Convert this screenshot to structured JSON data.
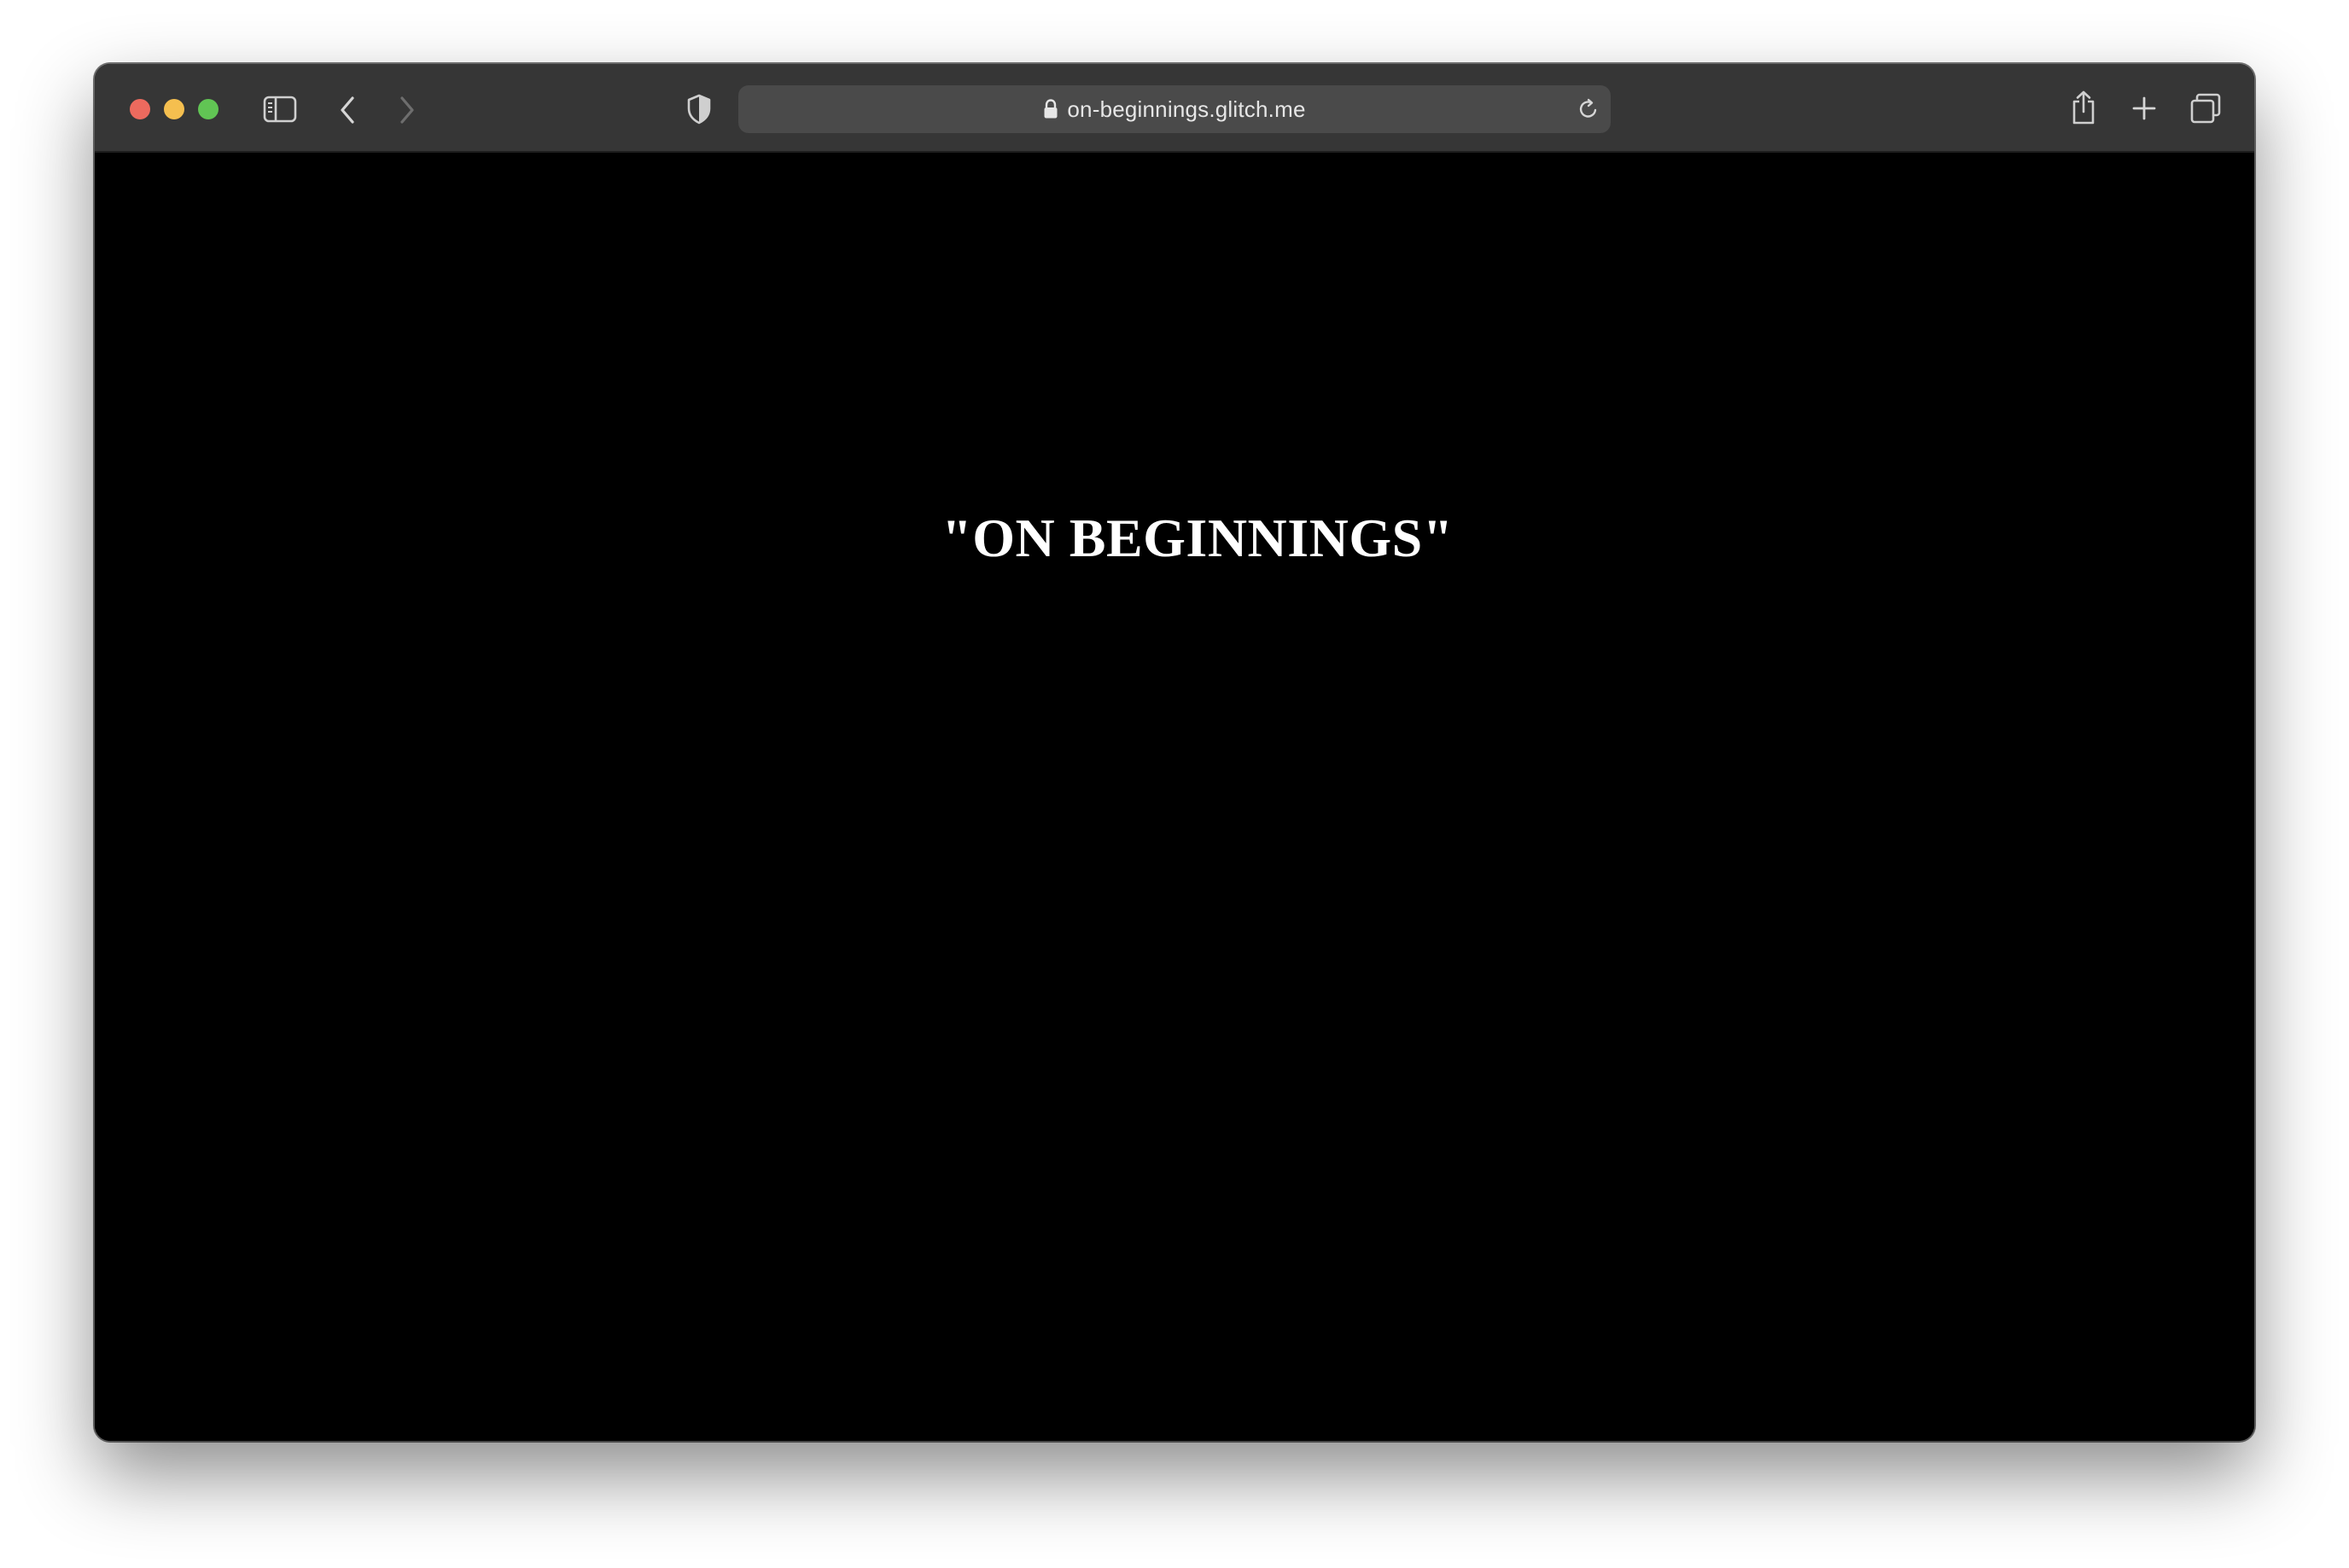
{
  "browser": {
    "address_bar": {
      "url": "on-beginnings.glitch.me"
    },
    "icons": {
      "sidebar": "sidebar-toggle-icon",
      "back": "chevron-left-icon",
      "forward": "chevron-right-icon",
      "privacy": "shield-icon",
      "lock": "lock-icon",
      "reload": "reload-icon",
      "share": "share-icon",
      "new_tab": "plus-icon",
      "tabs": "tab-overview-icon"
    },
    "colors": {
      "toolbar": "#363636",
      "address_bar": "#4a4a4a",
      "close": "#ed6a5e",
      "minimize": "#f5bf4f",
      "zoom": "#61c554",
      "page_background": "#000000",
      "heading": "#ffffff"
    }
  },
  "page": {
    "heading": "\"ON BEGINNINGS\""
  }
}
